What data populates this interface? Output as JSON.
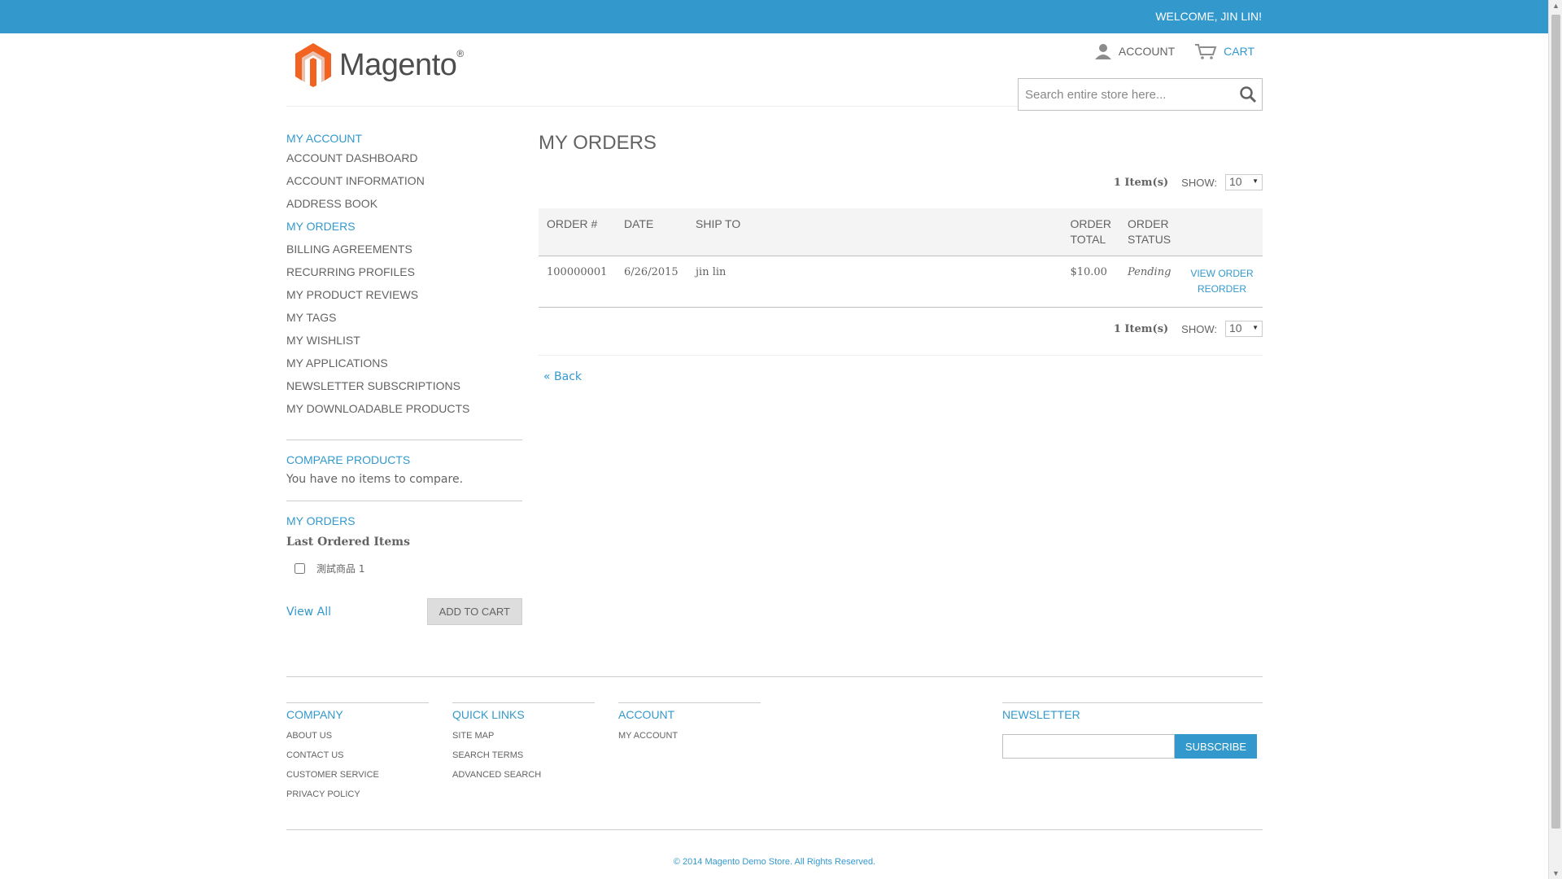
{
  "topbar": {
    "welcome": "WELCOME, JIN LIN!"
  },
  "header": {
    "logo_text": "Magento",
    "logo_mark": "®",
    "account_label": "ACCOUNT",
    "cart_label": "CART",
    "search_placeholder": "Search entire store here..."
  },
  "sidebar": {
    "account_title": "MY ACCOUNT",
    "items": [
      {
        "label": "ACCOUNT DASHBOARD"
      },
      {
        "label": "ACCOUNT INFORMATION"
      },
      {
        "label": "ADDRESS BOOK"
      },
      {
        "label": "MY ORDERS"
      },
      {
        "label": "BILLING AGREEMENTS"
      },
      {
        "label": "RECURRING PROFILES"
      },
      {
        "label": "MY PRODUCT REVIEWS"
      },
      {
        "label": "MY TAGS"
      },
      {
        "label": "MY WISHLIST"
      },
      {
        "label": "MY APPLICATIONS"
      },
      {
        "label": "NEWSLETTER SUBSCRIPTIONS"
      },
      {
        "label": "MY DOWNLOADABLE PRODUCTS"
      }
    ],
    "active_item": "MY ORDERS",
    "compare_title": "COMPARE PRODUCTS",
    "compare_text": "You have no items to compare.",
    "orders_title": "MY ORDERS",
    "last_ordered_title": "Last Ordered Items",
    "last_ordered_item": "測試商品 1",
    "view_all": "View All",
    "add_to_cart": "ADD TO CART"
  },
  "main": {
    "title": "MY ORDERS",
    "pager": {
      "count": "1 Item(s)",
      "show_label": "SHOW:",
      "show_value": "10"
    },
    "table": {
      "headers": [
        "ORDER #",
        "DATE",
        "SHIP TO",
        "ORDER TOTAL",
        "ORDER STATUS",
        ""
      ],
      "rows": [
        {
          "order": "100000001",
          "date": "6/26/2015",
          "ship_to": "jin lin",
          "total": "$10.00",
          "status": "Pending",
          "view": "VIEW ORDER",
          "reorder": "REORDER"
        }
      ]
    },
    "back": "« Back"
  },
  "footer": {
    "company": {
      "title": "COMPANY",
      "links": [
        "ABOUT US",
        "CONTACT US",
        "CUSTOMER SERVICE",
        "PRIVACY POLICY"
      ]
    },
    "quick_links": {
      "title": "QUICK LINKS",
      "links": [
        "SITE MAP",
        "SEARCH TERMS",
        "ADVANCED SEARCH"
      ]
    },
    "account": {
      "title": "ACCOUNT",
      "links": [
        "MY ACCOUNT"
      ]
    },
    "newsletter": {
      "title": "NEWSLETTER",
      "subscribe": "SUBSCRIBE"
    },
    "copyright": "© 2014 Magento Demo Store. All Rights Reserved."
  },
  "colors": {
    "accent": "#3399cc",
    "text": "#636363",
    "logo_orange": "#f26322"
  }
}
